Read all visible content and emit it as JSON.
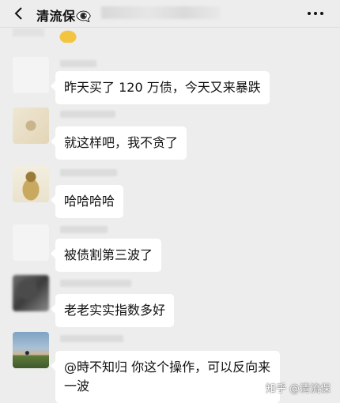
{
  "header": {
    "title": "清流保👁‍🗨",
    "back_icon": "back-chevron-icon",
    "more_icon": "more-dots-icon"
  },
  "messages": [
    {
      "avatar": "blurred-avatar",
      "text": "昨天买了 120 万债，今天又来暴跌"
    },
    {
      "avatar": "blurred-avatar",
      "text": "就这样吧，我不贪了"
    },
    {
      "avatar": "blurred-avatar",
      "text": "哈哈哈哈"
    },
    {
      "avatar": "blurred-avatar",
      "text": "被债割第三波了"
    },
    {
      "avatar": "blurred-avatar",
      "text": "老老实实指数多好"
    },
    {
      "avatar": "landscape-avatar",
      "text": "@時不知归  你这个操作，可以反向来一波"
    }
  ],
  "watermark": "知乎 @清流保",
  "colors": {
    "chat_background": "#ededed",
    "bubble": "#ffffff",
    "text": "#111111"
  }
}
